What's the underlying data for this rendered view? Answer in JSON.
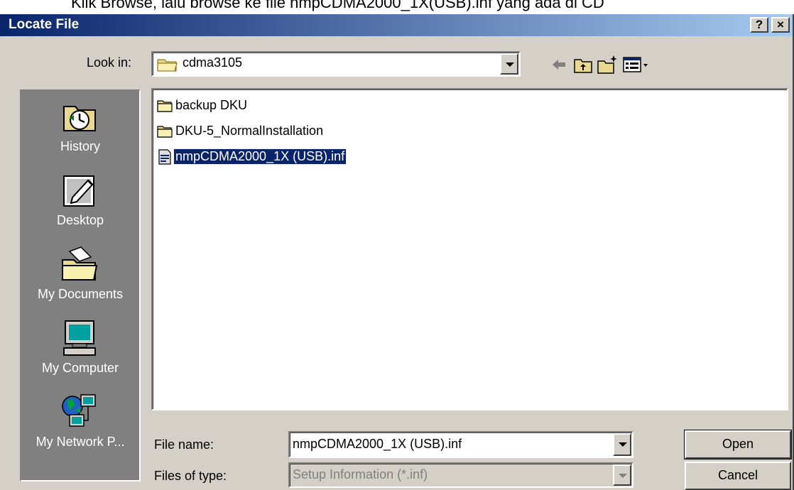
{
  "caption": "Klik Browse, lalu browse ke file nmpCDMA2000_1X(USB).inf yang ada di CD",
  "dialog": {
    "title": "Locate File",
    "help_label": "?",
    "close_label": "×"
  },
  "look_in": {
    "label": "Look in:",
    "value": "cdma3105"
  },
  "toolbar": {
    "back_icon": "back-arrow-icon",
    "up_icon": "up-folder-icon",
    "new_folder_icon": "new-folder-icon",
    "view_icon": "view-menu-icon"
  },
  "places": [
    {
      "label": "History",
      "icon": "history-icon"
    },
    {
      "label": "Desktop",
      "icon": "desktop-icon"
    },
    {
      "label": "My Documents",
      "icon": "my-documents-icon"
    },
    {
      "label": "My Computer",
      "icon": "my-computer-icon"
    },
    {
      "label": "My Network P...",
      "icon": "my-network-places-icon"
    }
  ],
  "files": [
    {
      "name": "backup DKU",
      "type": "folder",
      "selected": false
    },
    {
      "name": "DKU-5_NormalInstallation",
      "type": "folder",
      "selected": false
    },
    {
      "name": "nmpCDMA2000_1X (USB).inf",
      "type": "inf",
      "selected": true
    }
  ],
  "file_name": {
    "label": "File name:",
    "value": "nmpCDMA2000_1X (USB).inf"
  },
  "file_type": {
    "label": "Files of type:",
    "value": "Setup Information (*.inf)"
  },
  "buttons": {
    "open": "Open",
    "cancel": "Cancel"
  },
  "colors": {
    "title_start": "#0a246a",
    "title_end": "#a6caf0",
    "face": "#d4d0c8",
    "selection": "#0a246a"
  }
}
